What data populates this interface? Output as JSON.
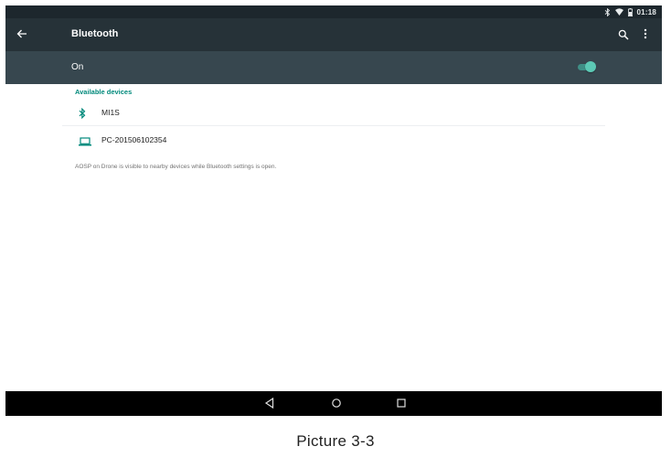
{
  "status_bar": {
    "time": "01:18",
    "icons": [
      "bluetooth-icon",
      "wifi-icon",
      "battery-icon"
    ]
  },
  "app_bar": {
    "title": "Bluetooth",
    "icons": [
      "back-arrow-icon",
      "search-icon",
      "more-vert-icon"
    ]
  },
  "bluetooth_switch": {
    "label": "On",
    "enabled": true,
    "accent_color": "#5cc9b5"
  },
  "available_devices": {
    "header": "Available devices",
    "header_color": "#00897b",
    "devices": [
      {
        "name": "MI1S",
        "icon": "bluetooth-icon"
      },
      {
        "name": "PC-201506102354",
        "icon": "laptop-icon"
      }
    ]
  },
  "visibility_note": "AOSP on Drone is visible to nearby devices while Bluetooth settings is open.",
  "nav_bar": {
    "icons": [
      "nav-back-icon",
      "nav-home-icon",
      "nav-recents-icon"
    ]
  },
  "caption": "Picture 3-3",
  "colors": {
    "app_bar": "#263238",
    "switch_bar": "#37474f",
    "status_bar": "#1d272d"
  }
}
